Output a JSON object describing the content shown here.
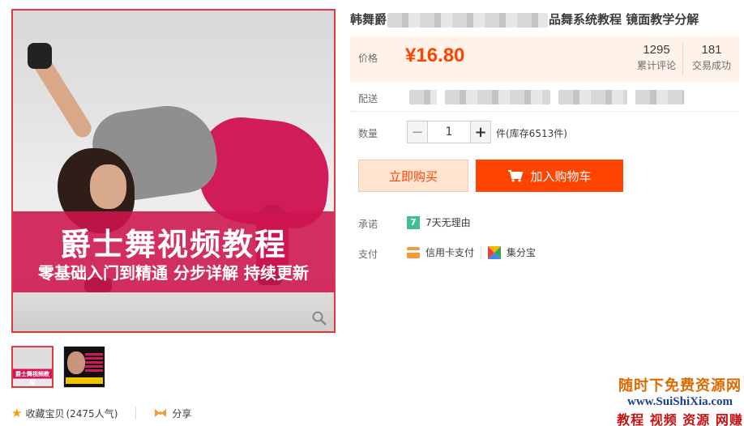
{
  "product": {
    "main_image": {
      "banner_title": "爵士舞视频教程",
      "banner_subtitle": "零基础入门到精通 分步详解 持续更新"
    },
    "thumbnails": [
      {
        "label": "爵士舞视频教程"
      },
      {
        "label": ""
      }
    ],
    "favorite": {
      "label": "收藏宝贝",
      "count": "(2475人气)"
    },
    "share_label": "分享",
    "title_prefix": "韩舞爵",
    "title_suffix": "品舞系统教程 镜面教学分解"
  },
  "price": {
    "label": "价格",
    "value": "¥16.80",
    "reviews": {
      "num": "1295",
      "label": "累计评论"
    },
    "trades": {
      "num": "181",
      "label": "交易成功"
    }
  },
  "delivery": {
    "label": "配送"
  },
  "quantity": {
    "label": "数量",
    "value": "1",
    "minus": "−",
    "plus": "+",
    "stock_text": "件(库存6513件)"
  },
  "actions": {
    "buy_now": "立即购买",
    "add_to_cart": "加入购物车"
  },
  "promise": {
    "label": "承诺",
    "icon_text": "7",
    "text": "7天无理由"
  },
  "payment": {
    "label": "支付",
    "methods": [
      "信用卡支付",
      "集分宝"
    ]
  },
  "watermark": {
    "line1": "随时下免费资源网",
    "line2": "www.SuiShiXia.com",
    "line3": "教程 视频 资源 网赚"
  },
  "colors": {
    "accent": "#ff4400",
    "price": "#ff4400",
    "banner": "#ce154d",
    "price_bg": "#fff2e8"
  }
}
